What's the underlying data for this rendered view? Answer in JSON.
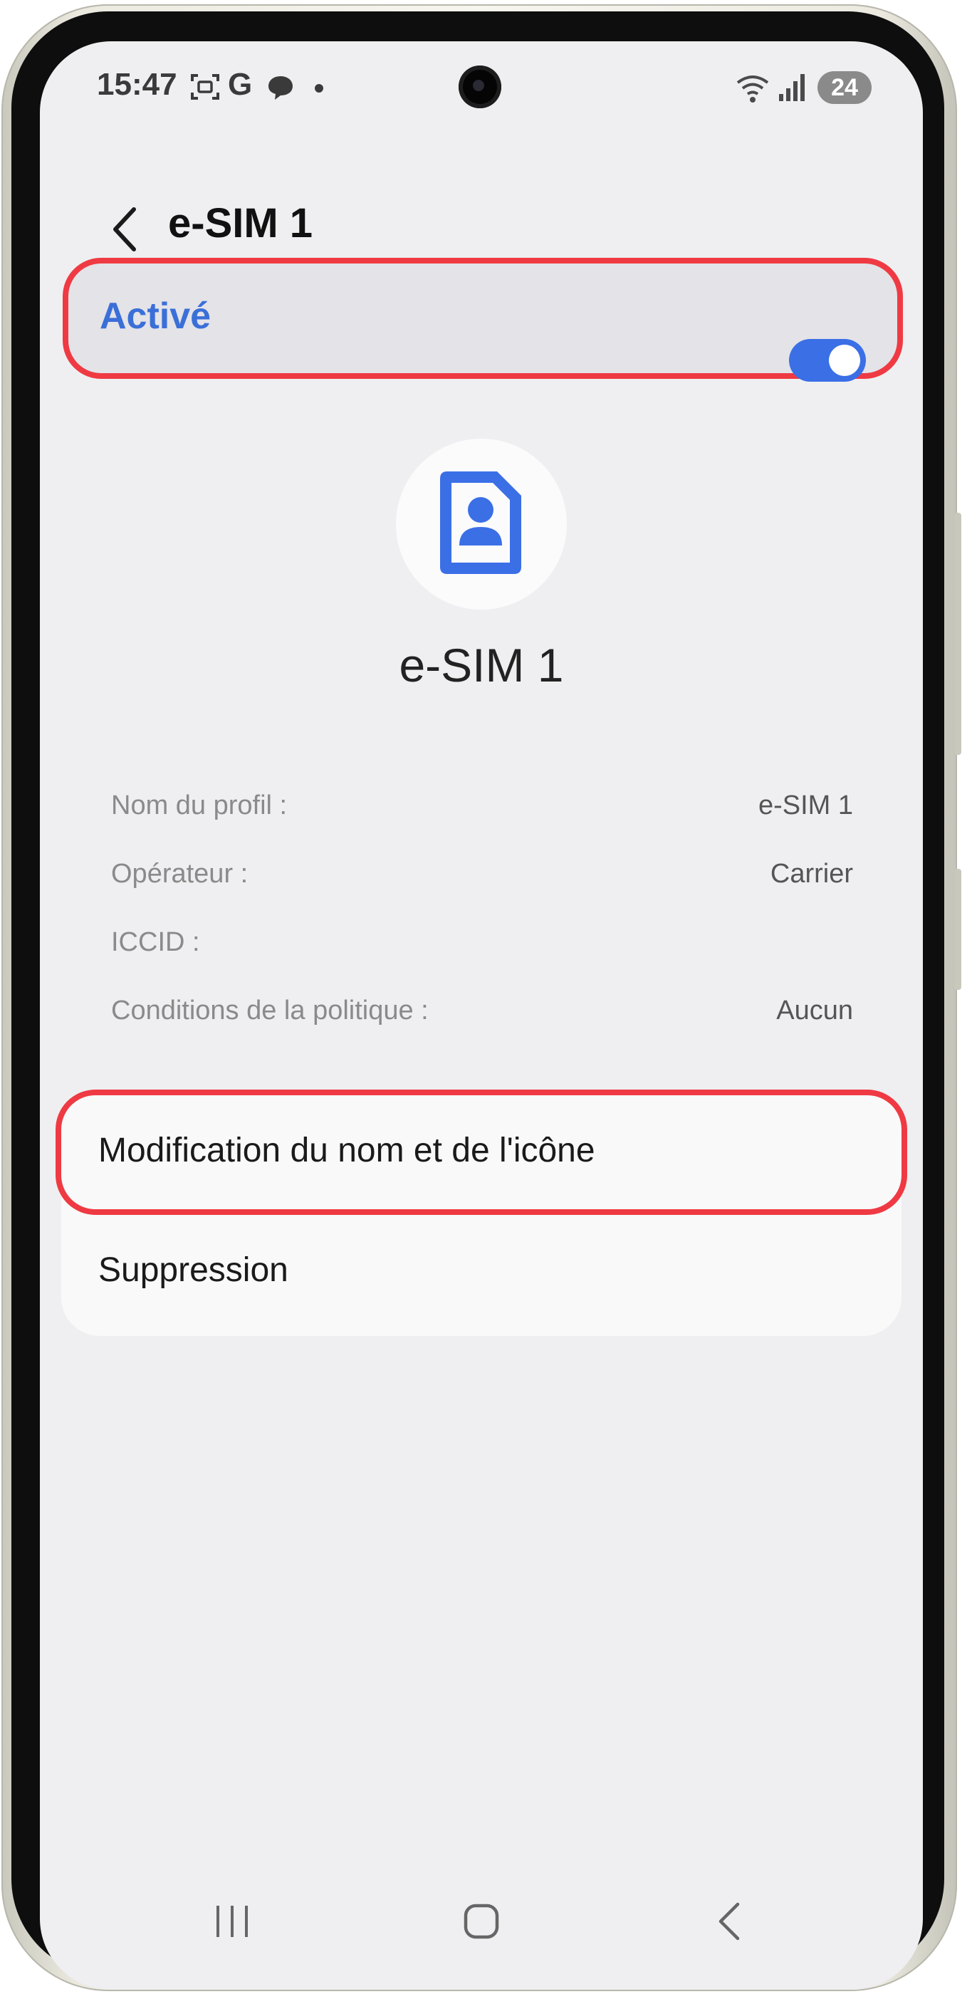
{
  "status_bar": {
    "time": "15:47",
    "icons": [
      "screenshot-icon",
      "google-icon",
      "chat-icon",
      "dot-icon",
      "wifi-icon",
      "signal-icon"
    ],
    "battery": "24"
  },
  "header": {
    "title": "e-SIM 1"
  },
  "toggle": {
    "label": "Activé",
    "state": "on",
    "accent_color": "#3b6fe6"
  },
  "profile": {
    "icon": "sim-card-user-icon",
    "name": "e-SIM 1"
  },
  "info": [
    {
      "label": "Nom du profil :",
      "value": "e-SIM 1"
    },
    {
      "label": "Opérateur :",
      "value": "Carrier"
    },
    {
      "label": "ICCID :",
      "value": ""
    },
    {
      "label": "Conditions de la politique :",
      "value": "Aucun"
    }
  ],
  "actions": [
    {
      "label": "Modification du nom et de l'icône"
    },
    {
      "label": "Suppression"
    }
  ],
  "highlight_color": "#ef3a43",
  "nav": [
    "recent-apps-icon",
    "home-icon",
    "back-icon"
  ]
}
